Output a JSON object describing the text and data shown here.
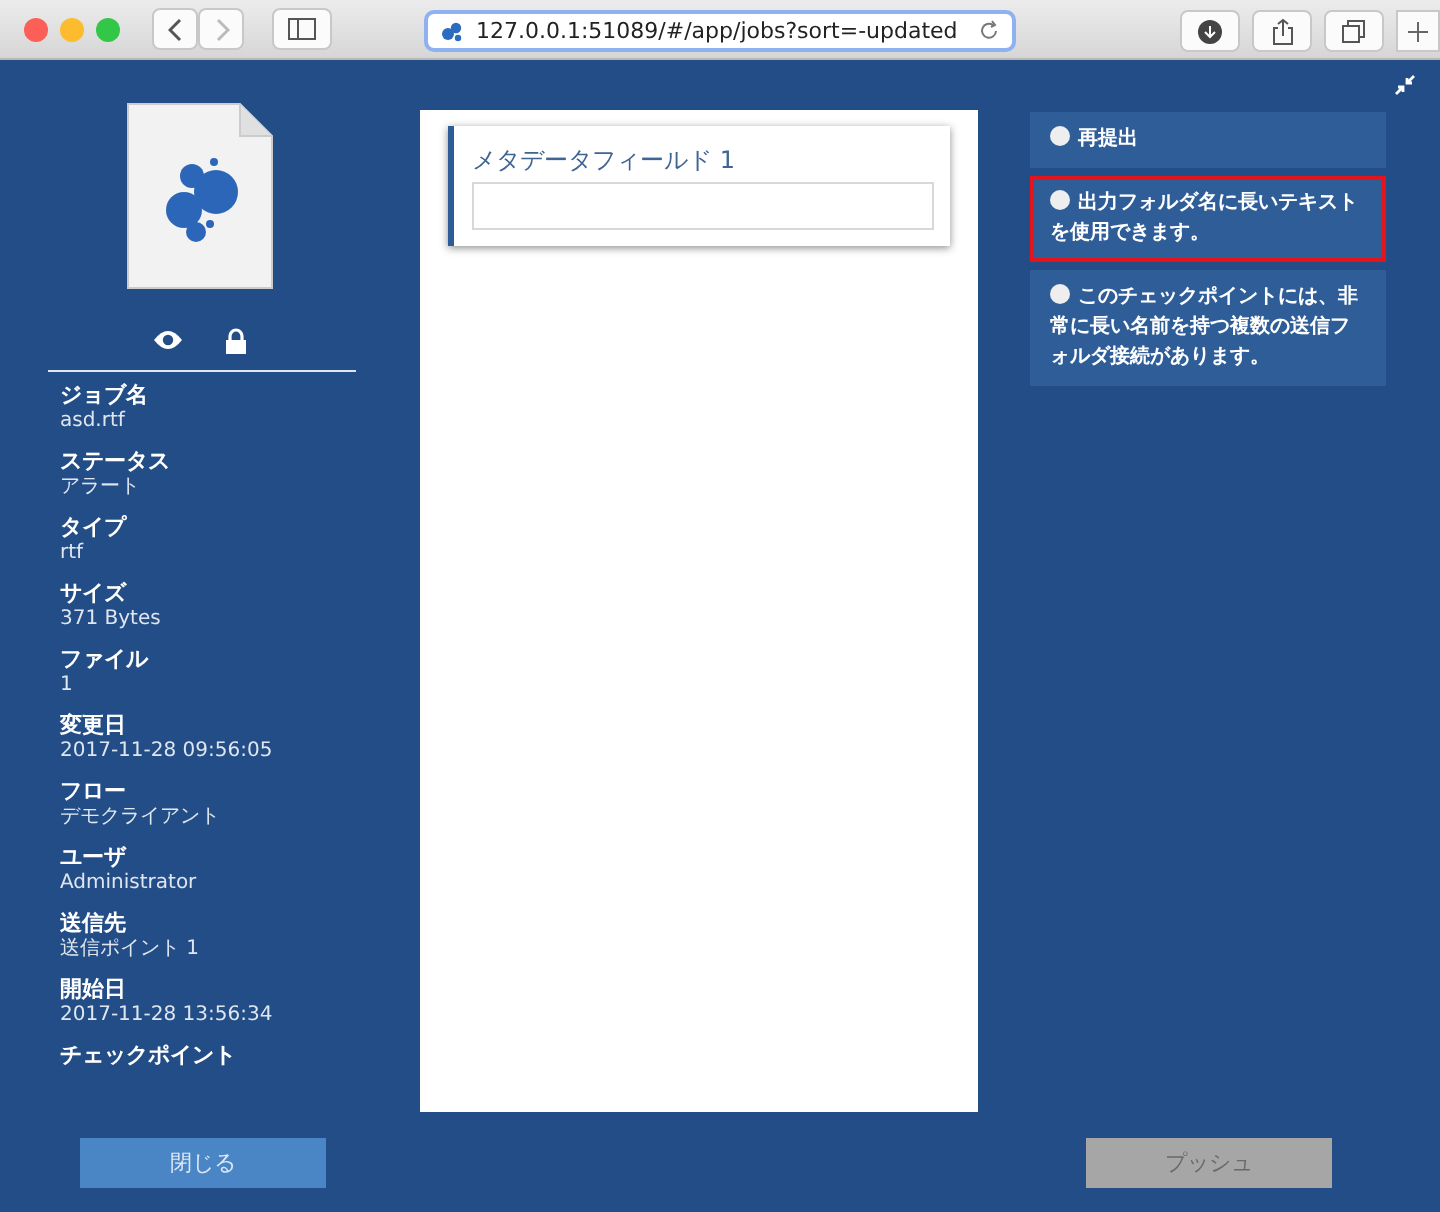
{
  "browser": {
    "url": "127.0.0.1:51089/#/app/jobs?sort=-updated"
  },
  "job_fields": [
    {
      "label": "ジョブ名",
      "value": "asd.rtf"
    },
    {
      "label": "ステータス",
      "value": "アラート"
    },
    {
      "label": "タイプ",
      "value": "rtf"
    },
    {
      "label": "サイズ",
      "value": "371 Bytes"
    },
    {
      "label": "ファイル",
      "value": "1"
    },
    {
      "label": "変更日",
      "value": "2017-11-28 09:56:05"
    },
    {
      "label": "フロー",
      "value": "デモクライアント"
    },
    {
      "label": "ユーザ",
      "value": "Administrator"
    },
    {
      "label": "送信先",
      "value": "送信ポイント 1"
    },
    {
      "label": "開始日",
      "value": "2017-11-28 13:56:34"
    },
    {
      "label": "チェックポイント"
    }
  ],
  "metadata_field": {
    "label": "メタデータフィールド 1"
  },
  "options": [
    {
      "label": "再提出",
      "selected": false
    },
    {
      "label": "出力フォルダ名に長いテキストを使用できます。",
      "selected": true
    },
    {
      "label": "このチェックポイントには、非常に長い名前を持つ複数の送信フォルダ接続があります。",
      "selected": false
    }
  ],
  "close_button": {
    "label": "閉じる",
    "disabled": false
  },
  "push_button": {
    "label": "プッシュ",
    "disabled": true
  }
}
